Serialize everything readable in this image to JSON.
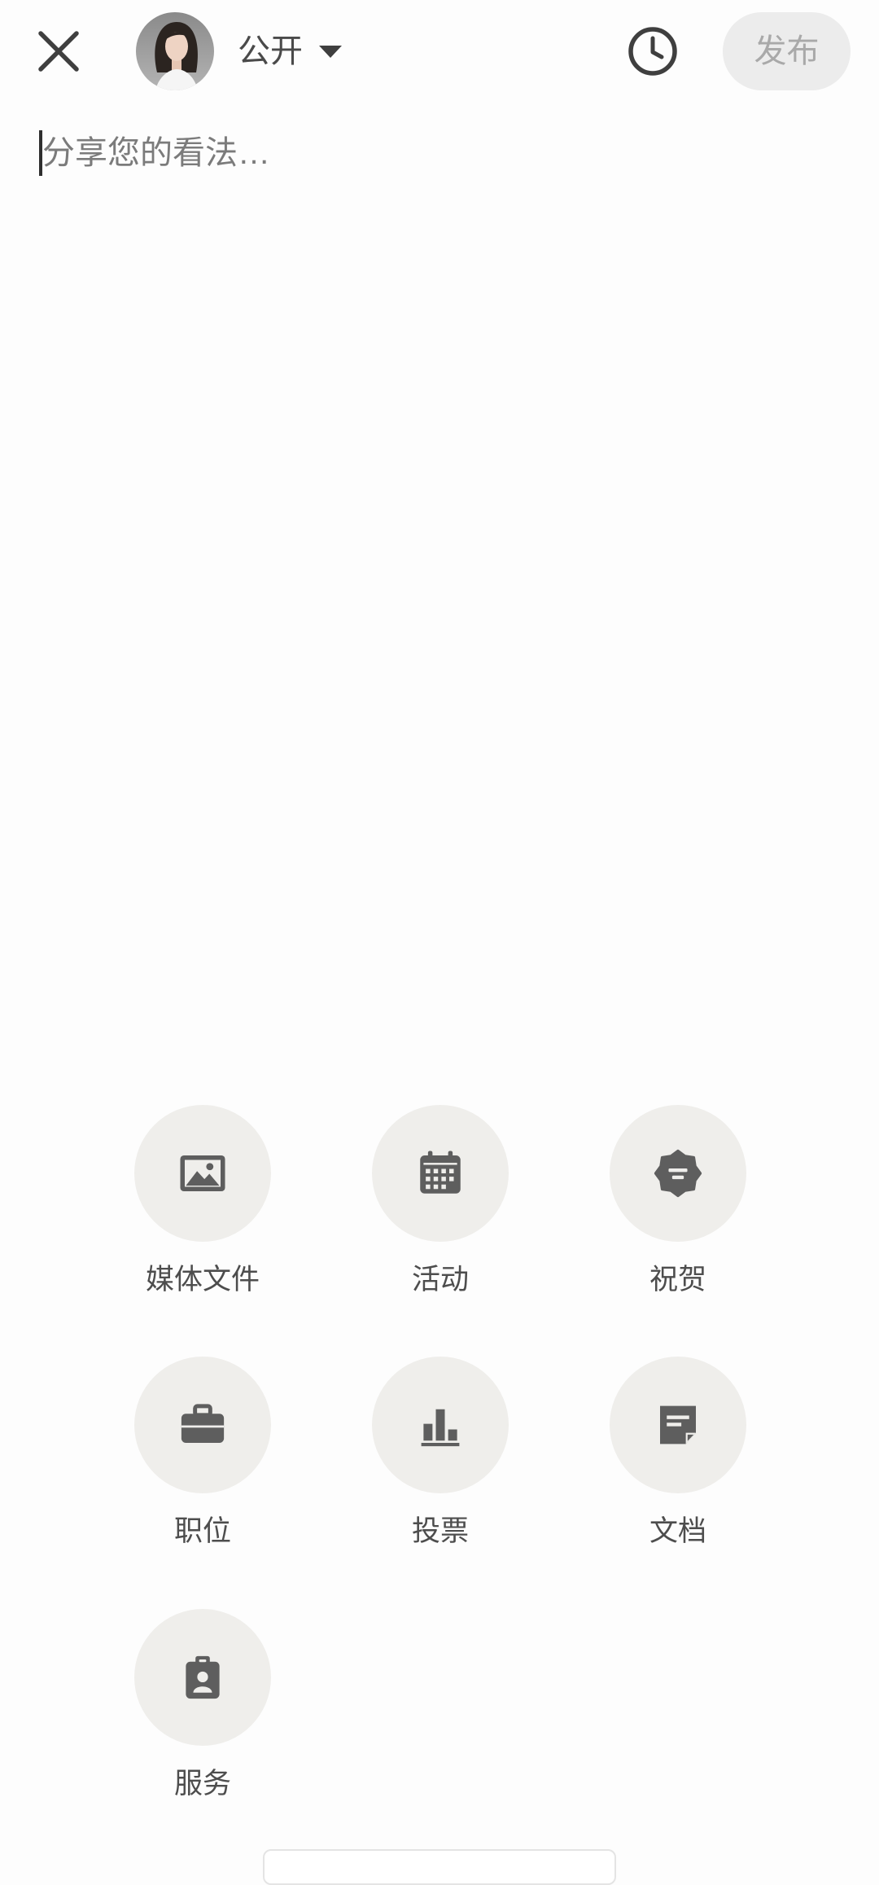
{
  "header": {
    "close_icon": "close-icon",
    "avatar": "avatar",
    "visibility": {
      "label": "公开",
      "icon": "caret-down-icon"
    },
    "schedule_icon": "clock-icon",
    "publish_label": "发布"
  },
  "composer": {
    "placeholder": "分享您的看法…"
  },
  "actions": [
    {
      "label": "媒体文件",
      "icon": "image-icon"
    },
    {
      "label": "活动",
      "icon": "calendar-icon"
    },
    {
      "label": "祝贺",
      "icon": "celebrate-badge-icon"
    },
    {
      "label": "职位",
      "icon": "briefcase-icon"
    },
    {
      "label": "投票",
      "icon": "bar-chart-icon"
    },
    {
      "label": "文档",
      "icon": "document-icon"
    },
    {
      "label": "服务",
      "icon": "id-badge-icon"
    }
  ],
  "colors": {
    "page_bg": "#fdfdfd",
    "circle_bg": "#efeeeb",
    "icon": "#5e5e5e",
    "label": "#4d4d4d",
    "placeholder": "#7b7b7b",
    "publish_bg": "#ececec",
    "publish_text": "#a9a9a9"
  }
}
